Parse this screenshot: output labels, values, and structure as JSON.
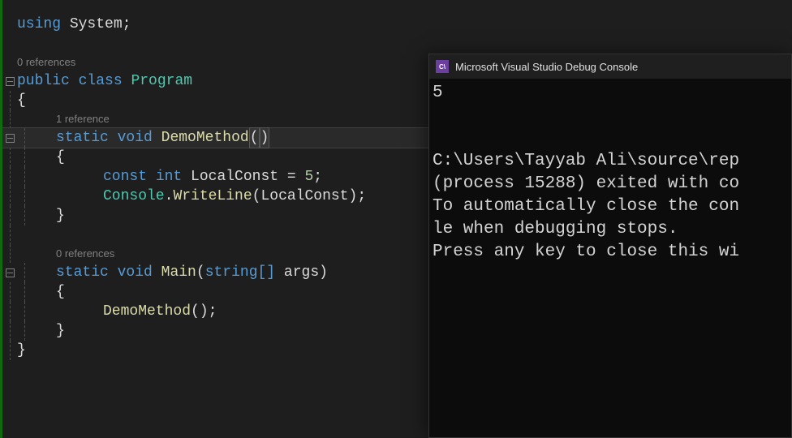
{
  "editor": {
    "codelens": {
      "class_refs": "0 references",
      "demomethod_refs": "1 reference",
      "main_refs": "0 references"
    },
    "tokens": {
      "using": "using",
      "system": "System",
      "semicolon": ";",
      "public": "public",
      "class": "class",
      "program": "Program",
      "lbrace": "{",
      "rbrace": "}",
      "static": "static",
      "void": "void",
      "demoMethod": "DemoMethod",
      "lparen": "(",
      "rparen": ")",
      "const": "const",
      "int": "int",
      "localConst": "LocalConst",
      "eq": " = ",
      "five": "5",
      "console": "Console",
      "dot": ".",
      "writeLine": "WriteLine",
      "main": "Main",
      "string_arr": "string[]",
      "args": " args"
    }
  },
  "console": {
    "title": "Microsoft Visual Studio Debug Console",
    "output_value": "5",
    "lines": {
      "l1": "C:\\Users\\Tayyab Ali\\source\\rep",
      "l2": "(process 15288) exited with co",
      "l3": "To automatically close the con",
      "l4": "le when debugging stops.",
      "l5": "Press any key to close this wi"
    }
  }
}
